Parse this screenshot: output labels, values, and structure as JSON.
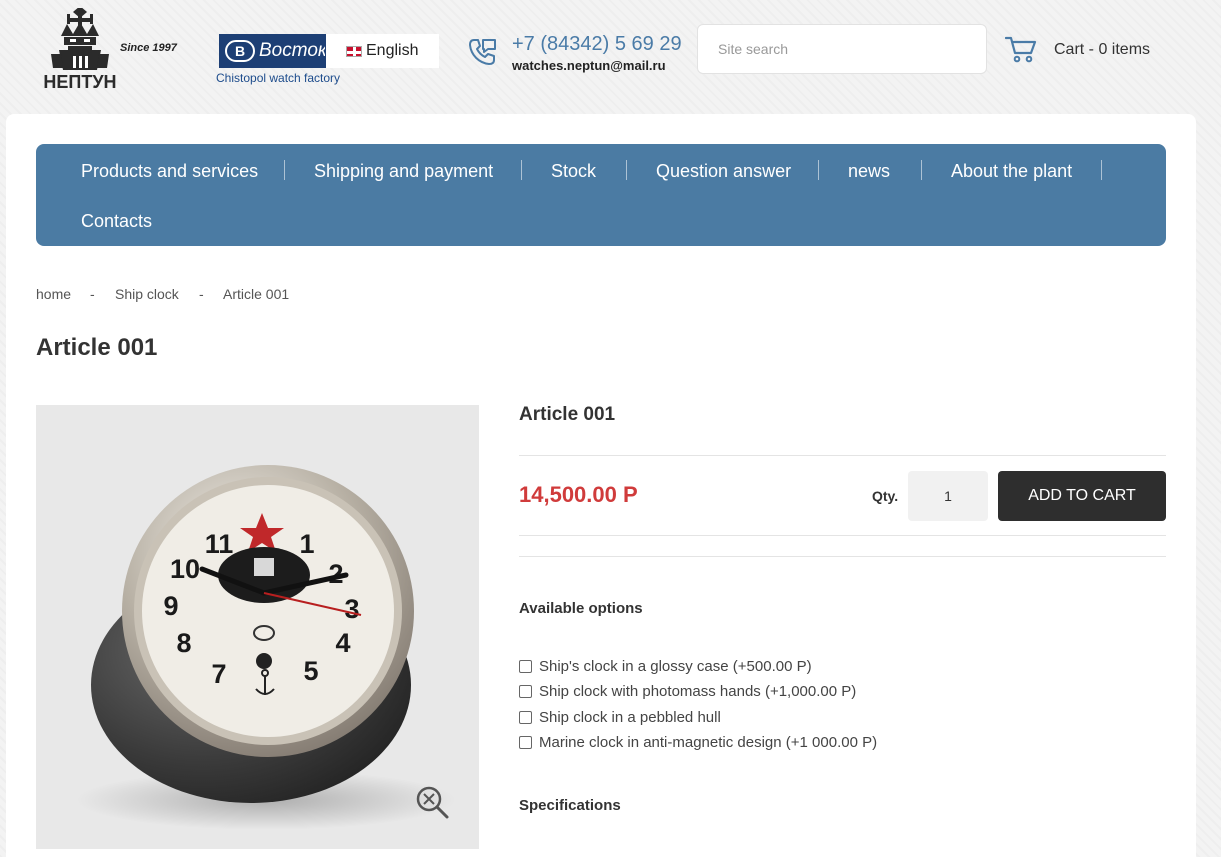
{
  "header": {
    "since": "Since 1997",
    "logo_text": "НЕПТУН",
    "vostok_text": "Восток",
    "vostok_letter": "В",
    "language": "English",
    "factory": "Chistopol watch factory",
    "phone": "+7 (84342) 5 69 29",
    "email": "watches.neptun@mail.ru",
    "search_placeholder": "Site search",
    "cart": "Cart - 0 items"
  },
  "nav": {
    "items": [
      "Products and services",
      "Shipping and payment",
      "Stock",
      "Question answer",
      "news",
      "About the plant",
      "Contacts"
    ]
  },
  "breadcrumb": {
    "items": [
      "home",
      "Ship clock",
      "Article 001"
    ],
    "separator": "-"
  },
  "page_title": "Article 001",
  "product": {
    "name": "Article 001",
    "price": "14,500.00 Р",
    "qty_label": "Qty.",
    "qty_value": "1",
    "add_to_cart": "ADD TO CART",
    "options_title": "Available options",
    "options": [
      "Ship's clock in a glossy case (+500.00 Р)",
      "Ship clock with photomass hands (+1,000.00 Р)",
      "Ship clock in a pebbled hull",
      "Marine clock in anti-magnetic design (+1 000.00 Р)"
    ],
    "specs_title": "Specifications",
    "clock_numerals": [
      "11",
      "1",
      "2",
      "3",
      "4",
      "5",
      "7",
      "8",
      "9",
      "10"
    ]
  },
  "colors": {
    "nav_bg": "#4b7ba3",
    "price": "#d03b3b",
    "button_bg": "#2e2e2e",
    "vostok_bg": "#1d3f75"
  }
}
